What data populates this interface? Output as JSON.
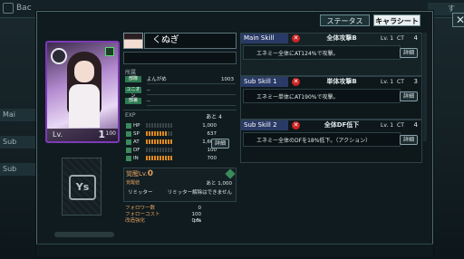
{
  "background": {
    "back_label": "Bac",
    "right_label": "す",
    "side_items": [
      "Mai",
      "Sub",
      "Sub"
    ]
  },
  "tabs": {
    "status": "ステータス",
    "chara_sheet": "キャラシート"
  },
  "close_glyph": "✕",
  "card": {
    "level_label": "Lv.",
    "level": "1",
    "level_max": "100"
  },
  "slot": {
    "vs_text": "Ys"
  },
  "character": {
    "name": "くぬぎ"
  },
  "affiliation": {
    "label": "所属",
    "rows": [
      {
        "tag": "部隊",
        "value": "よんがめ",
        "extra": "1003"
      },
      {
        "tag": "ユニオン",
        "value": "--",
        "extra": ""
      },
      {
        "tag": "部署",
        "value": "--",
        "extra": ""
      }
    ]
  },
  "exp": {
    "label": "EXP",
    "remaining_label": "あと",
    "remaining": "4",
    "detail_label": "詳細",
    "stats": [
      {
        "name": "HP",
        "filled": 0,
        "value": "1,000"
      },
      {
        "name": "SP",
        "filled": 8,
        "value": "637"
      },
      {
        "name": "AT",
        "filled": 10,
        "value": "1,600"
      },
      {
        "name": "DF",
        "filled": 0,
        "value": "100"
      },
      {
        "name": "IN",
        "filled": 10,
        "value": "700"
      }
    ]
  },
  "awaken": {
    "title": "覚醒Lv.",
    "level": "0",
    "sub": "覚醒値",
    "remaining": "あと 1,000",
    "limit_label": "リミッター",
    "limit_value": "リミッター解除はできません"
  },
  "follow": {
    "rows": [
      {
        "label": "フォロワー数",
        "value": "0",
        "unit": ""
      },
      {
        "label": "フォローコスト",
        "value": "100",
        "unit": "pts"
      },
      {
        "label": "改造強化",
        "value": "0",
        "unit": "%"
      }
    ]
  },
  "skills": [
    {
      "header": "Main Skill",
      "name": "全体攻撃B",
      "lv_label": "Lv.",
      "lv": "1",
      "ct_label": "CT",
      "ct": "4",
      "desc": "エネミー全体にAT124%で攻撃。",
      "detail": "詳細"
    },
    {
      "header": "Sub Skill 1",
      "name": "単体攻撃B",
      "lv_label": "Lv.",
      "lv": "1",
      "ct_label": "CT",
      "ct": "3",
      "desc": "エネミー単体にAT190%で攻撃。",
      "detail": "詳細"
    },
    {
      "header": "Sub Skill 2",
      "name": "全体DF低下",
      "lv_label": "Lv.",
      "lv": "1",
      "ct_label": "CT",
      "ct": "4",
      "desc": "エネミー全体のDFを18%低下。（アクション）",
      "detail": "詳細"
    }
  ],
  "colors": {
    "accent_tab": "#e9f0f1",
    "skill_header": "#2a3a66",
    "stat_bar": "#e08a1c",
    "card_frame": "#7b3bb5"
  }
}
